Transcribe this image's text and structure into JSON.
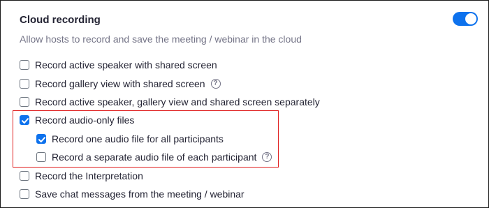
{
  "setting": {
    "title": "Cloud recording",
    "description": "Allow hosts to record and save the meeting / webinar in the cloud",
    "enabled": true
  },
  "options": [
    {
      "label": "Record active speaker with shared screen",
      "checked": false
    },
    {
      "label": "Record gallery view with shared screen",
      "checked": false,
      "help": "?"
    },
    {
      "label": "Record active speaker, gallery view and shared screen separately",
      "checked": false
    },
    {
      "label": "Record audio-only files",
      "checked": true
    },
    {
      "label": "Record one audio file for all participants",
      "checked": true
    },
    {
      "label": "Record a separate audio file of each participant",
      "checked": false,
      "help": "?"
    },
    {
      "label": "Record the Interpretation",
      "checked": false
    },
    {
      "label": "Save chat messages from the meeting / webinar",
      "checked": false
    }
  ],
  "colors": {
    "accent": "#0e72ed",
    "highlight": "#e02020"
  }
}
